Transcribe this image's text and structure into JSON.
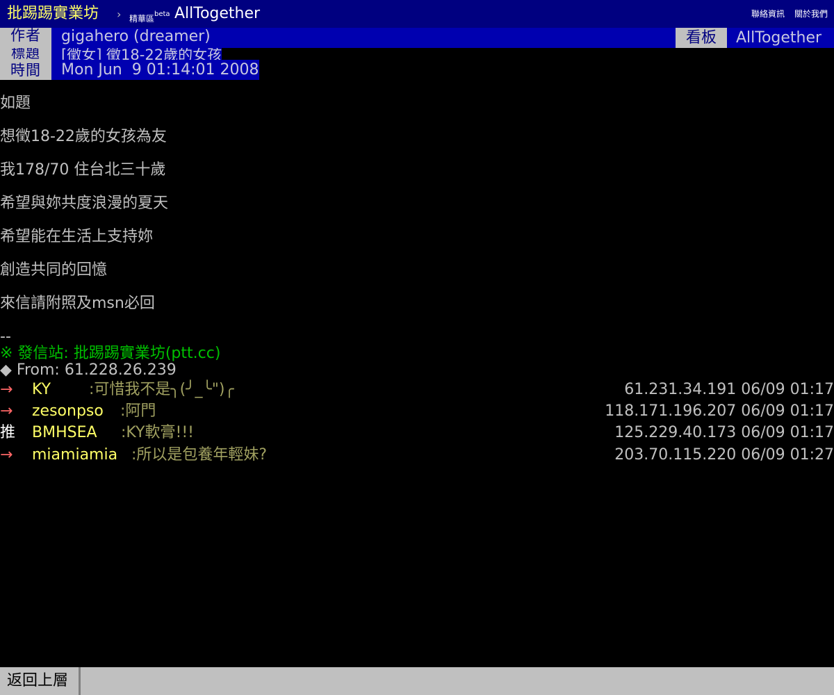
{
  "topbar": {
    "site_name": "批踢踢實業坊",
    "chevron": "›",
    "section": "精華區",
    "section_sup": "beta",
    "board": "AllTogether",
    "links": [
      "聯絡資訊",
      "關於我們"
    ]
  },
  "meta": {
    "author_tag": "作者",
    "author": "gigahero (dreamer)",
    "title_tag": "標題",
    "title": "[徵女] 徵18-22歲的女孩",
    "time_tag": "時間",
    "time": "Mon Jun  9 01:14:01 2008",
    "board_tag": "看板",
    "board": "AllTogether"
  },
  "content": [
    "如題",
    "想徵18-22歲的女孩為友",
    "我178/70 住台北三十歲",
    "希望與妳共度浪漫的夏天",
    "希望能在生活上支持妳",
    "創造共同的回憶",
    "來信請附照及msn必回"
  ],
  "signature": {
    "dashes": "--",
    "station": "※ 發信站: 批踢踢實業坊(ptt.cc)",
    "from": "◆ From: 61.228.26.239"
  },
  "pushes": [
    {
      "tag": "→",
      "user": "KY",
      "msg": ":可惜我不是╮(╯_╰\")╭",
      "ipdt": "61.231.34.191 06/09 01:17"
    },
    {
      "tag": "→",
      "user": "zesonpso",
      "msg": ":阿門",
      "ipdt": "118.171.196.207 06/09 01:17"
    },
    {
      "tag": "推",
      "user": "BMHSEA",
      "msg": ":KY軟膏!!!",
      "ipdt": "125.229.40.173 06/09 01:17"
    },
    {
      "tag": "→",
      "user": "miamiamia",
      "msg": ":所以是包養年輕妹?",
      "ipdt": "203.70.115.220 06/09 01:27"
    }
  ],
  "colors": {
    "background": "#000000",
    "topbar": "#000080",
    "site_name": "#ffff66",
    "meta_value_bg": "#0000b0",
    "meta_tag_bg": "#c0c0c0",
    "arrow_tag": "#ff6666",
    "push_tag": "#ffffff",
    "user": "#ffff66",
    "message": "#a0a060",
    "signature_green": "#00c000"
  },
  "bottombar": {
    "back_label": "返回上層"
  }
}
